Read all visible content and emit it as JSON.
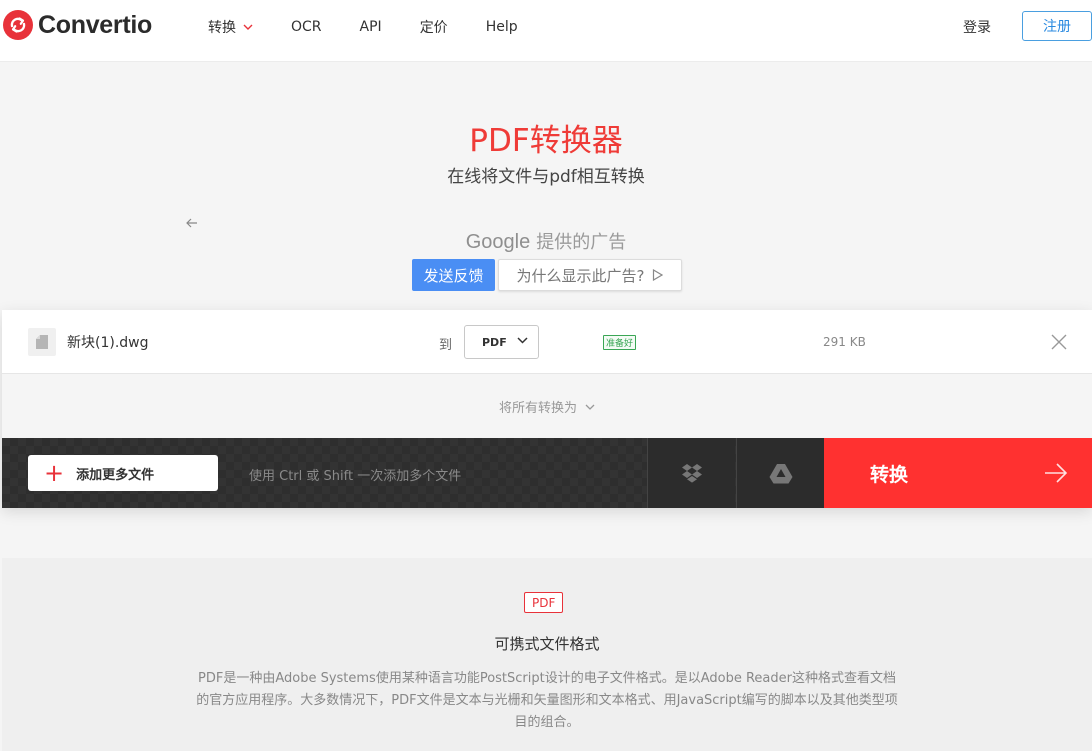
{
  "header": {
    "logo_text": "Convertio",
    "nav": [
      {
        "label": "转换",
        "has_dropdown": true
      },
      {
        "label": "OCR"
      },
      {
        "label": "API"
      },
      {
        "label": "定价"
      },
      {
        "label": "Help"
      }
    ],
    "login": "登录",
    "signup": "注册"
  },
  "hero": {
    "title": "PDF转换器",
    "subtitle": "在线将文件与pdf相互转换"
  },
  "ad": {
    "provider": "Google",
    "provided_text": "提供的广告",
    "feedback_button": "发送反馈",
    "why_button": "为什么显示此广告?"
  },
  "converter": {
    "file": {
      "name": "新块(1).dwg",
      "to_label": "到",
      "target_format": "PDF",
      "status": "准备好",
      "size": "291 KB"
    },
    "convert_all_label": "将所有转换为",
    "add_files_label": "添加更多文件",
    "hint": "使用 Ctrl 或 Shift 一次添加多个文件",
    "convert_button": "转换"
  },
  "info": {
    "badge": "PDF",
    "title": "可携式文件格式",
    "description": "PDF是一种由Adobe Systems使用某种语言功能PostScript设计的电子文件格式。是以Adobe Reader这种格式查看文档的官方应用程序。大多数情况下，PDF文件是文本与光栅和矢量图形和文本格式、用JavaScript编写的脚本以及其他类型项目的组合。"
  },
  "colors": {
    "brand_red": "#ff3130",
    "link_blue": "#2a8ae0",
    "ready_green": "#3aa655"
  }
}
